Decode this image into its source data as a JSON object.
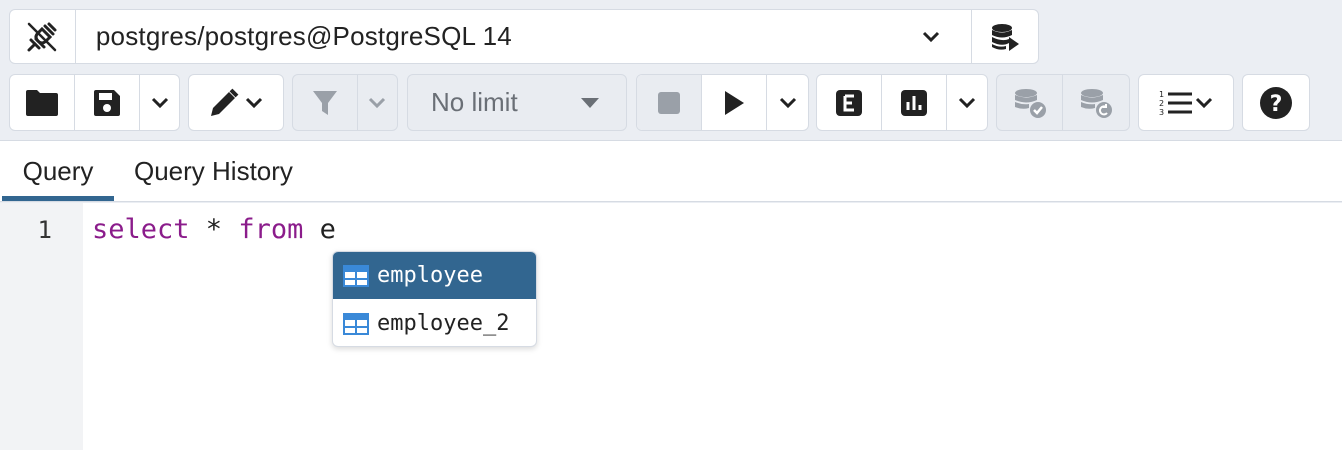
{
  "connection": {
    "label": "postgres/postgres@PostgreSQL 14",
    "icons": [
      "disconnect-plug-icon",
      "chevron-down-icon",
      "execute-database-icon"
    ]
  },
  "toolbar": {
    "row_limit": "No limit",
    "icons": [
      "open-folder-icon",
      "save-icon",
      "chevron-down-icon",
      "edit-pencil-icon",
      "chevron-down-icon",
      "filter-icon",
      "chevron-down-icon",
      "caret-down-icon",
      "stop-icon",
      "play-icon",
      "chevron-down-icon",
      "explain-icon",
      "explain-analyze-icon",
      "chevron-down-icon",
      "commit-icon",
      "rollback-icon",
      "macros-list-icon",
      "chevron-down-icon",
      "help-icon"
    ]
  },
  "tabs": [
    {
      "label": "Query",
      "active": true
    },
    {
      "label": "Query History",
      "active": false
    }
  ],
  "editor": {
    "line_number": "1",
    "tokens": {
      "kw1": "select",
      "star": " * ",
      "kw2": "from",
      "rest": " e"
    }
  },
  "autocomplete": {
    "items": [
      {
        "label": "employee",
        "icon": "table-icon",
        "selected": true
      },
      {
        "label": "employee_2",
        "icon": "table-icon",
        "selected": false
      }
    ]
  },
  "colors": {
    "accent": "#326690",
    "keyword": "#8b1c8b"
  }
}
